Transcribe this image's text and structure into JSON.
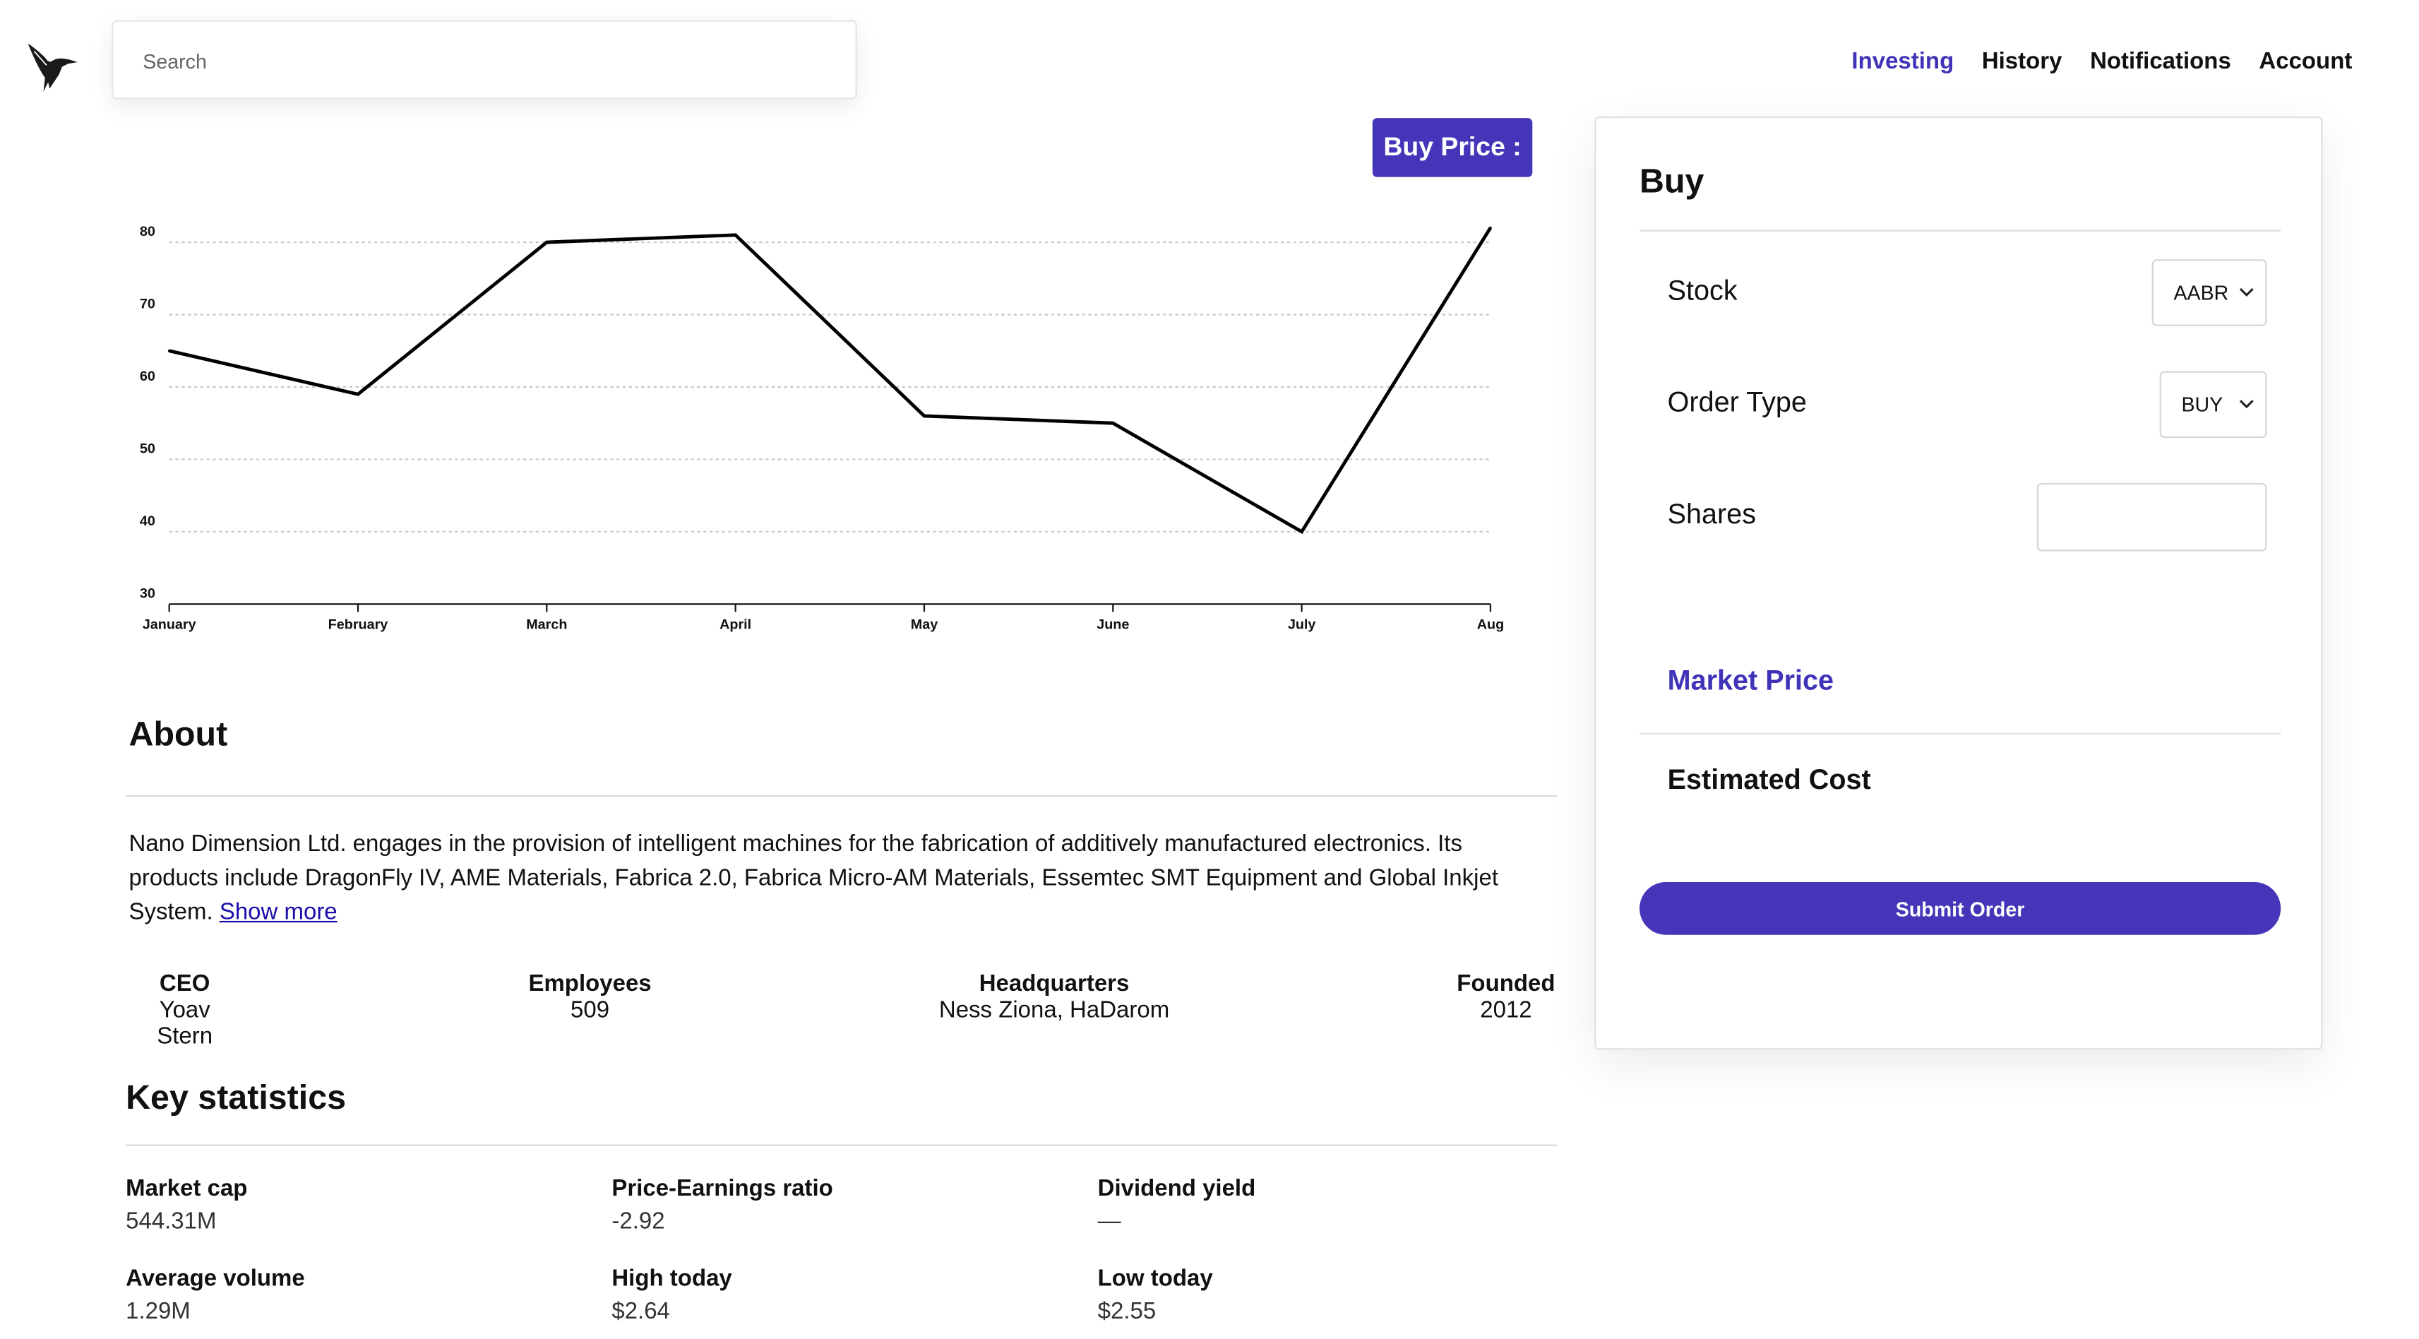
{
  "header": {
    "logo_icon": "hummingbird-icon",
    "search": {
      "placeholder": "Search"
    },
    "nav": [
      {
        "label": "Investing",
        "active": true
      },
      {
        "label": "History",
        "active": false
      },
      {
        "label": "Notifications",
        "active": false
      },
      {
        "label": "Account",
        "active": false
      }
    ]
  },
  "buy_price_button": {
    "label": "Buy Price :"
  },
  "chart_data": {
    "type": "line",
    "categories": [
      "January",
      "February",
      "March",
      "April",
      "May",
      "June",
      "July",
      "Aug"
    ],
    "values": [
      65,
      59,
      80,
      81,
      56,
      55,
      40,
      82
    ],
    "yticks": [
      30,
      40,
      50,
      60,
      70,
      80
    ],
    "ylim": [
      30,
      80
    ],
    "grid": true,
    "line_color": "#000000"
  },
  "about": {
    "title": "About",
    "description": "Nano Dimension Ltd. engages in the provision of intelligent machines for the fabrication of additively manufactured electronics. Its products include DragonFly IV, AME Materials, Fabrica 2.0, Fabrica Micro-AM Materials, Essemtec SMT Equipment and Global Inkjet System.",
    "show_more": "Show more",
    "facts": [
      {
        "label": "CEO",
        "value": "Yoav Stern"
      },
      {
        "label": "Employees",
        "value": "509"
      },
      {
        "label": "Headquarters",
        "value": "Ness Ziona, HaDarom"
      },
      {
        "label": "Founded",
        "value": "2012"
      }
    ]
  },
  "key_statistics": {
    "title": "Key statistics",
    "items": [
      {
        "label": "Market cap",
        "value": "544.31M"
      },
      {
        "label": "Price-Earnings ratio",
        "value": "-2.92"
      },
      {
        "label": "Dividend yield",
        "value": "—"
      },
      {
        "label": "Average volume",
        "value": "1.29M"
      },
      {
        "label": "High today",
        "value": "$2.64"
      },
      {
        "label": "Low today",
        "value": "$2.55"
      }
    ]
  },
  "order_panel": {
    "title": "Buy",
    "stock": {
      "label": "Stock",
      "selected": "AABR"
    },
    "order_type": {
      "label": "Order Type",
      "selected": "BUY"
    },
    "shares": {
      "label": "Shares",
      "value": ""
    },
    "market_price_label": "Market Price",
    "estimated_cost_label": "Estimated Cost",
    "submit_label": "Submit Order"
  },
  "colors": {
    "accent": "#4535b8",
    "accent_text": "#3f33b8"
  }
}
